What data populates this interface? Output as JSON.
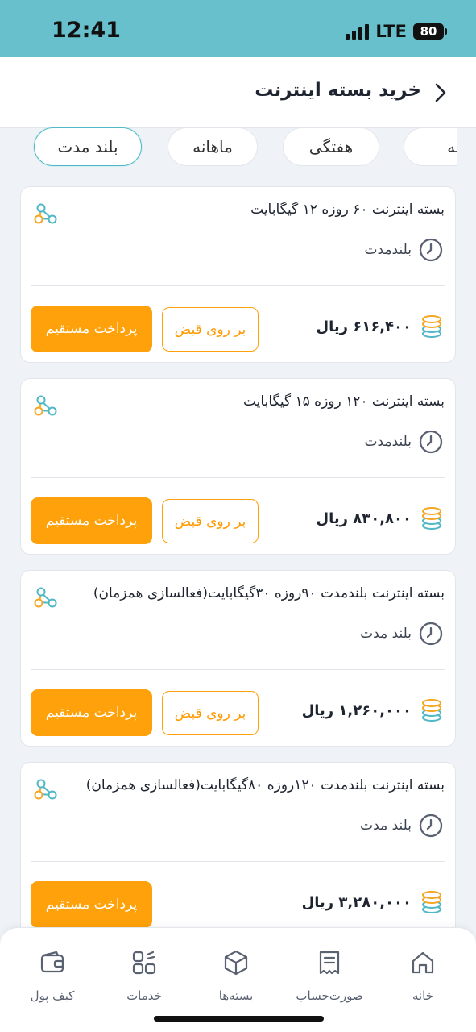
{
  "status_bar": {
    "time": "12:41",
    "network": "LTE",
    "battery": "80"
  },
  "header": {
    "title": "خرید بسته اینترنت"
  },
  "tabs": [
    {
      "label": "بلند مدت",
      "active": true
    },
    {
      "label": "ماهانه",
      "active": false
    },
    {
      "label": "هفتگی",
      "active": false
    },
    {
      "label": "روزانه",
      "active": false
    }
  ],
  "packages": [
    {
      "title": "بسته اینترنت ۶۰ روزه ۱۲ گیگابایت",
      "duration": "بلندمدت",
      "price": "۶۱۶,۴۰۰ ریال",
      "bill_label": "بر روی قبض",
      "direct_label": "پرداخت مستقیم"
    },
    {
      "title": "بسته اینترنت ۱۲۰ روزه ۱۵ گیگابایت",
      "duration": "بلندمدت",
      "price": "۸۳۰,۸۰۰ ریال",
      "bill_label": "بر روی قبض",
      "direct_label": "پرداخت مستقیم"
    },
    {
      "title": "بسته اینترنت بلندمدت ۹۰روزه ۳۰گیگابایت(فعالسازی همزمان)",
      "duration": "بلند مدت",
      "price": "۱,۲۶۰,۰۰۰ ریال",
      "bill_label": "بر روی قبض",
      "direct_label": "پرداخت مستقیم"
    },
    {
      "title": "بسته اینترنت بلندمدت ۱۲۰روزه ۸۰گیگابایت(فعالسازی همزمان)",
      "duration": "بلند مدت",
      "price": "۳,۲۸۰,۰۰۰ ریال",
      "direct_label": "پرداخت مستقیم"
    }
  ],
  "bottom_nav": [
    {
      "label": "خانه",
      "icon": "home-icon"
    },
    {
      "label": "صورت‌حساب",
      "icon": "invoice-icon"
    },
    {
      "label": "بسته‌ها",
      "icon": "package-icon"
    },
    {
      "label": "خدمات",
      "icon": "services-grid-icon"
    },
    {
      "label": "کیف پول",
      "icon": "wallet-icon"
    }
  ],
  "colors": {
    "status_bar": "#69c0cd",
    "accent_orange": "#ffa10a",
    "active_tab_border": "#4fb8c6",
    "icon_teal": "#4fb8c6",
    "icon_orange": "#f5a623"
  }
}
